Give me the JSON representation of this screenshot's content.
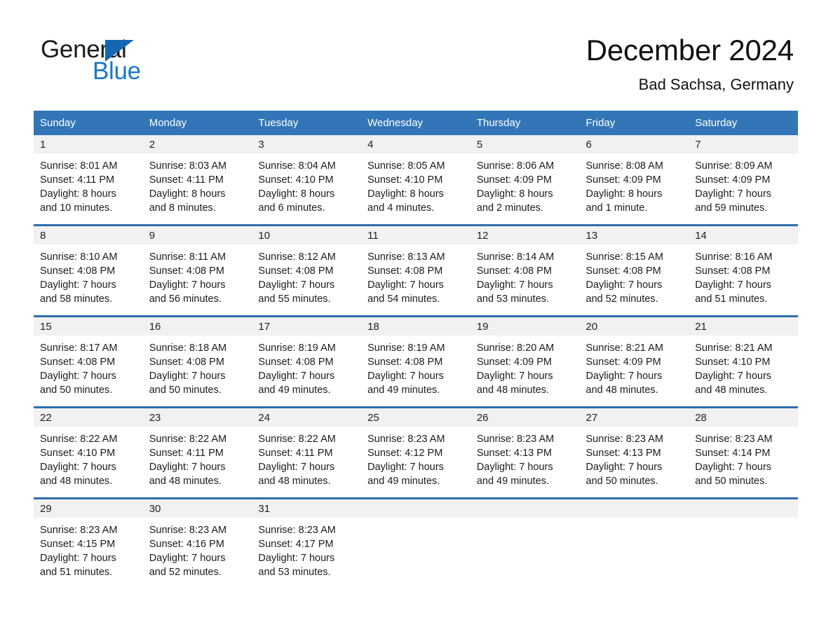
{
  "brand": {
    "name_part1": "General",
    "name_part2": "Blue",
    "triangle_icon": "triangle-icon",
    "accent_color": "#1878c8"
  },
  "header": {
    "title": "December 2024",
    "subtitle": "Bad Sachsa, Germany"
  },
  "colors": {
    "header_blue": "#3276b8",
    "row_rule_blue": "#2f6eb0",
    "daynum_band": "#f1f1f1"
  },
  "weekday_headers": [
    "Sunday",
    "Monday",
    "Tuesday",
    "Wednesday",
    "Thursday",
    "Friday",
    "Saturday"
  ],
  "weeks": [
    [
      {
        "day": "1",
        "sunrise": "Sunrise: 8:01 AM",
        "sunset": "Sunset: 4:11 PM",
        "daylight_line1": "Daylight: 8 hours",
        "daylight_line2": "and 10 minutes."
      },
      {
        "day": "2",
        "sunrise": "Sunrise: 8:03 AM",
        "sunset": "Sunset: 4:11 PM",
        "daylight_line1": "Daylight: 8 hours",
        "daylight_line2": "and 8 minutes."
      },
      {
        "day": "3",
        "sunrise": "Sunrise: 8:04 AM",
        "sunset": "Sunset: 4:10 PM",
        "daylight_line1": "Daylight: 8 hours",
        "daylight_line2": "and 6 minutes."
      },
      {
        "day": "4",
        "sunrise": "Sunrise: 8:05 AM",
        "sunset": "Sunset: 4:10 PM",
        "daylight_line1": "Daylight: 8 hours",
        "daylight_line2": "and 4 minutes."
      },
      {
        "day": "5",
        "sunrise": "Sunrise: 8:06 AM",
        "sunset": "Sunset: 4:09 PM",
        "daylight_line1": "Daylight: 8 hours",
        "daylight_line2": "and 2 minutes."
      },
      {
        "day": "6",
        "sunrise": "Sunrise: 8:08 AM",
        "sunset": "Sunset: 4:09 PM",
        "daylight_line1": "Daylight: 8 hours",
        "daylight_line2": "and 1 minute."
      },
      {
        "day": "7",
        "sunrise": "Sunrise: 8:09 AM",
        "sunset": "Sunset: 4:09 PM",
        "daylight_line1": "Daylight: 7 hours",
        "daylight_line2": "and 59 minutes."
      }
    ],
    [
      {
        "day": "8",
        "sunrise": "Sunrise: 8:10 AM",
        "sunset": "Sunset: 4:08 PM",
        "daylight_line1": "Daylight: 7 hours",
        "daylight_line2": "and 58 minutes."
      },
      {
        "day": "9",
        "sunrise": "Sunrise: 8:11 AM",
        "sunset": "Sunset: 4:08 PM",
        "daylight_line1": "Daylight: 7 hours",
        "daylight_line2": "and 56 minutes."
      },
      {
        "day": "10",
        "sunrise": "Sunrise: 8:12 AM",
        "sunset": "Sunset: 4:08 PM",
        "daylight_line1": "Daylight: 7 hours",
        "daylight_line2": "and 55 minutes."
      },
      {
        "day": "11",
        "sunrise": "Sunrise: 8:13 AM",
        "sunset": "Sunset: 4:08 PM",
        "daylight_line1": "Daylight: 7 hours",
        "daylight_line2": "and 54 minutes."
      },
      {
        "day": "12",
        "sunrise": "Sunrise: 8:14 AM",
        "sunset": "Sunset: 4:08 PM",
        "daylight_line1": "Daylight: 7 hours",
        "daylight_line2": "and 53 minutes."
      },
      {
        "day": "13",
        "sunrise": "Sunrise: 8:15 AM",
        "sunset": "Sunset: 4:08 PM",
        "daylight_line1": "Daylight: 7 hours",
        "daylight_line2": "and 52 minutes."
      },
      {
        "day": "14",
        "sunrise": "Sunrise: 8:16 AM",
        "sunset": "Sunset: 4:08 PM",
        "daylight_line1": "Daylight: 7 hours",
        "daylight_line2": "and 51 minutes."
      }
    ],
    [
      {
        "day": "15",
        "sunrise": "Sunrise: 8:17 AM",
        "sunset": "Sunset: 4:08 PM",
        "daylight_line1": "Daylight: 7 hours",
        "daylight_line2": "and 50 minutes."
      },
      {
        "day": "16",
        "sunrise": "Sunrise: 8:18 AM",
        "sunset": "Sunset: 4:08 PM",
        "daylight_line1": "Daylight: 7 hours",
        "daylight_line2": "and 50 minutes."
      },
      {
        "day": "17",
        "sunrise": "Sunrise: 8:19 AM",
        "sunset": "Sunset: 4:08 PM",
        "daylight_line1": "Daylight: 7 hours",
        "daylight_line2": "and 49 minutes."
      },
      {
        "day": "18",
        "sunrise": "Sunrise: 8:19 AM",
        "sunset": "Sunset: 4:08 PM",
        "daylight_line1": "Daylight: 7 hours",
        "daylight_line2": "and 49 minutes."
      },
      {
        "day": "19",
        "sunrise": "Sunrise: 8:20 AM",
        "sunset": "Sunset: 4:09 PM",
        "daylight_line1": "Daylight: 7 hours",
        "daylight_line2": "and 48 minutes."
      },
      {
        "day": "20",
        "sunrise": "Sunrise: 8:21 AM",
        "sunset": "Sunset: 4:09 PM",
        "daylight_line1": "Daylight: 7 hours",
        "daylight_line2": "and 48 minutes."
      },
      {
        "day": "21",
        "sunrise": "Sunrise: 8:21 AM",
        "sunset": "Sunset: 4:10 PM",
        "daylight_line1": "Daylight: 7 hours",
        "daylight_line2": "and 48 minutes."
      }
    ],
    [
      {
        "day": "22",
        "sunrise": "Sunrise: 8:22 AM",
        "sunset": "Sunset: 4:10 PM",
        "daylight_line1": "Daylight: 7 hours",
        "daylight_line2": "and 48 minutes."
      },
      {
        "day": "23",
        "sunrise": "Sunrise: 8:22 AM",
        "sunset": "Sunset: 4:11 PM",
        "daylight_line1": "Daylight: 7 hours",
        "daylight_line2": "and 48 minutes."
      },
      {
        "day": "24",
        "sunrise": "Sunrise: 8:22 AM",
        "sunset": "Sunset: 4:11 PM",
        "daylight_line1": "Daylight: 7 hours",
        "daylight_line2": "and 48 minutes."
      },
      {
        "day": "25",
        "sunrise": "Sunrise: 8:23 AM",
        "sunset": "Sunset: 4:12 PM",
        "daylight_line1": "Daylight: 7 hours",
        "daylight_line2": "and 49 minutes."
      },
      {
        "day": "26",
        "sunrise": "Sunrise: 8:23 AM",
        "sunset": "Sunset: 4:13 PM",
        "daylight_line1": "Daylight: 7 hours",
        "daylight_line2": "and 49 minutes."
      },
      {
        "day": "27",
        "sunrise": "Sunrise: 8:23 AM",
        "sunset": "Sunset: 4:13 PM",
        "daylight_line1": "Daylight: 7 hours",
        "daylight_line2": "and 50 minutes."
      },
      {
        "day": "28",
        "sunrise": "Sunrise: 8:23 AM",
        "sunset": "Sunset: 4:14 PM",
        "daylight_line1": "Daylight: 7 hours",
        "daylight_line2": "and 50 minutes."
      }
    ],
    [
      {
        "day": "29",
        "sunrise": "Sunrise: 8:23 AM",
        "sunset": "Sunset: 4:15 PM",
        "daylight_line1": "Daylight: 7 hours",
        "daylight_line2": "and 51 minutes."
      },
      {
        "day": "30",
        "sunrise": "Sunrise: 8:23 AM",
        "sunset": "Sunset: 4:16 PM",
        "daylight_line1": "Daylight: 7 hours",
        "daylight_line2": "and 52 minutes."
      },
      {
        "day": "31",
        "sunrise": "Sunrise: 8:23 AM",
        "sunset": "Sunset: 4:17 PM",
        "daylight_line1": "Daylight: 7 hours",
        "daylight_line2": "and 53 minutes."
      },
      {
        "day": "",
        "sunrise": "",
        "sunset": "",
        "daylight_line1": "",
        "daylight_line2": ""
      },
      {
        "day": "",
        "sunrise": "",
        "sunset": "",
        "daylight_line1": "",
        "daylight_line2": ""
      },
      {
        "day": "",
        "sunrise": "",
        "sunset": "",
        "daylight_line1": "",
        "daylight_line2": ""
      },
      {
        "day": "",
        "sunrise": "",
        "sunset": "",
        "daylight_line1": "",
        "daylight_line2": ""
      }
    ]
  ]
}
